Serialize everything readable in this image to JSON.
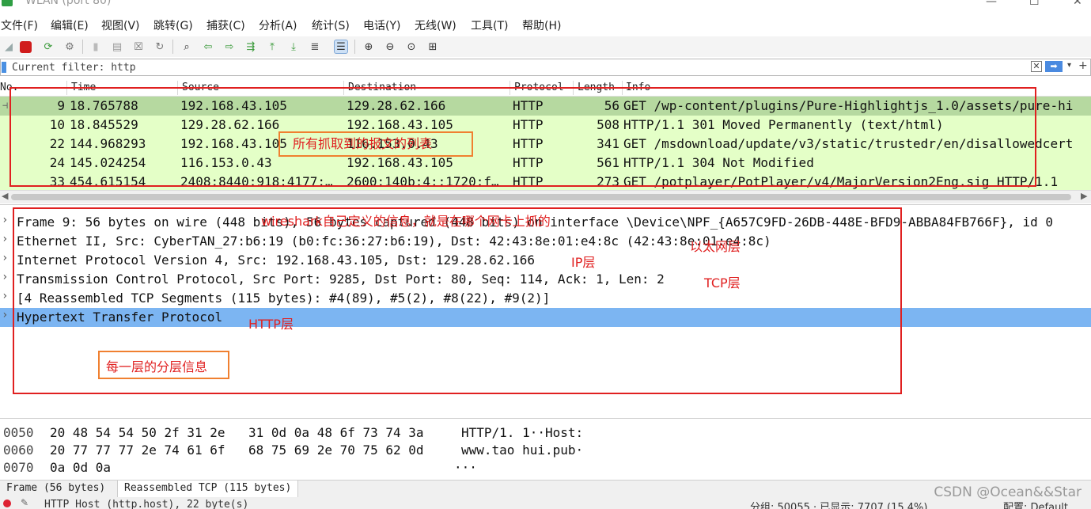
{
  "window": {
    "title": "WLAN (port 80)"
  },
  "menu": [
    "文件(F)",
    "编辑(E)",
    "视图(V)",
    "跳转(G)",
    "捕获(C)",
    "分析(A)",
    "统计(S)",
    "电话(Y)",
    "无线(W)",
    "工具(T)",
    "帮助(H)"
  ],
  "filter": {
    "value": "Current filter: http"
  },
  "packet_list": {
    "columns": [
      "No.",
      "Time",
      "Source",
      "Destination",
      "Protocol",
      "Length",
      "Info"
    ],
    "rows": [
      {
        "no": "9",
        "time": "18.765788",
        "src": "192.168.43.105",
        "dst": "129.28.62.166",
        "proto": "HTTP",
        "len": "56",
        "info": "GET /wp-content/plugins/Pure-Highlightjs_1.0/assets/pure-hi"
      },
      {
        "no": "10",
        "time": "18.845529",
        "src": "129.28.62.166",
        "dst": "192.168.43.105",
        "proto": "HTTP",
        "len": "508",
        "info": "HTTP/1.1 301 Moved Permanently  (text/html)"
      },
      {
        "no": "22",
        "time": "144.968293",
        "src": "192.168.43.105",
        "dst": "116.153.0.43",
        "proto": "HTTP",
        "len": "341",
        "info": "GET /msdownload/update/v3/static/trustedr/en/disallowedcert"
      },
      {
        "no": "24",
        "time": "145.024254",
        "src": "116.153.0.43",
        "dst": "192.168.43.105",
        "proto": "HTTP",
        "len": "561",
        "info": "HTTP/1.1 304 Not Modified"
      },
      {
        "no": "33",
        "time": "454.615154",
        "src": "2408:8440:918:4177:…",
        "dst": "2600:140b:4::1720:f…",
        "proto": "HTTP",
        "len": "273",
        "info": "GET /potplayer/PotPlayer/v4/MajorVersion2Eng.sig HTTP/1.1"
      }
    ]
  },
  "details": [
    "Frame 9: 56 bytes on wire (448 bits), 56 bytes captured (448 bits) on interface \\Device\\NPF_{A657C9FD-26DB-448E-BFD9-ABBA84FB766F}, id 0",
    "Ethernet II, Src: CyberTAN_27:b6:19 (b0:fc:36:27:b6:19), Dst: 42:43:8e:01:e4:8c (42:43:8e:01:e4:8c)",
    "Internet Protocol Version 4, Src: 192.168.43.105, Dst: 129.28.62.166",
    "Transmission Control Protocol, Src Port: 9285, Dst Port: 80, Seq: 114, Ack: 1, Len: 2",
    "[4 Reassembled TCP Segments (115 bytes): #4(89), #5(2), #8(22), #9(2)]",
    "Hypertext Transfer Protocol"
  ],
  "bytes": [
    {
      "offset": "0050",
      "hex1": "20 48 54 54 50 2f 31 2e",
      "hex2": "31 0d 0a 48 6f 73 74 3a",
      "ascii": "HTTP/1. 1··Host:"
    },
    {
      "offset": "0060",
      "hex1": "20 77 77 77 2e 74 61 6f",
      "hex2": "68 75 69 2e 70 75 62 0d",
      "ascii": "www.tao hui.pub·"
    },
    {
      "offset": "0070",
      "hex1": "0a 0d 0a",
      "hex2": "",
      "ascii": "···"
    }
  ],
  "tabs": [
    "Frame (56 bytes)",
    "Reassembled TCP (115 bytes)"
  ],
  "status": {
    "left": "HTTP Host (http.host), 22 byte(s)",
    "groups": "分组: 50055 · 已显示: 7707 (15.4%)",
    "profile": "配置: Default"
  },
  "annotations": {
    "packet_list": "所有抓取到的报文的列表",
    "wireshark_note": "wireshark自己定义的信息，就是在哪个网卡上抓的",
    "ethernet": "以太网层",
    "ip": "IP层",
    "tcp": "TCP层",
    "http": "HTTP层",
    "layers": "每一层的分层信息"
  },
  "watermark": "CSDN @Ocean&&Star",
  "colors": {
    "http_row": "#e4ffc7",
    "selected_row": "#b6d9a0",
    "selected_detail": "#7cb5f2",
    "annotation_red": "#e02020",
    "annotation_orange": "#f08030"
  }
}
